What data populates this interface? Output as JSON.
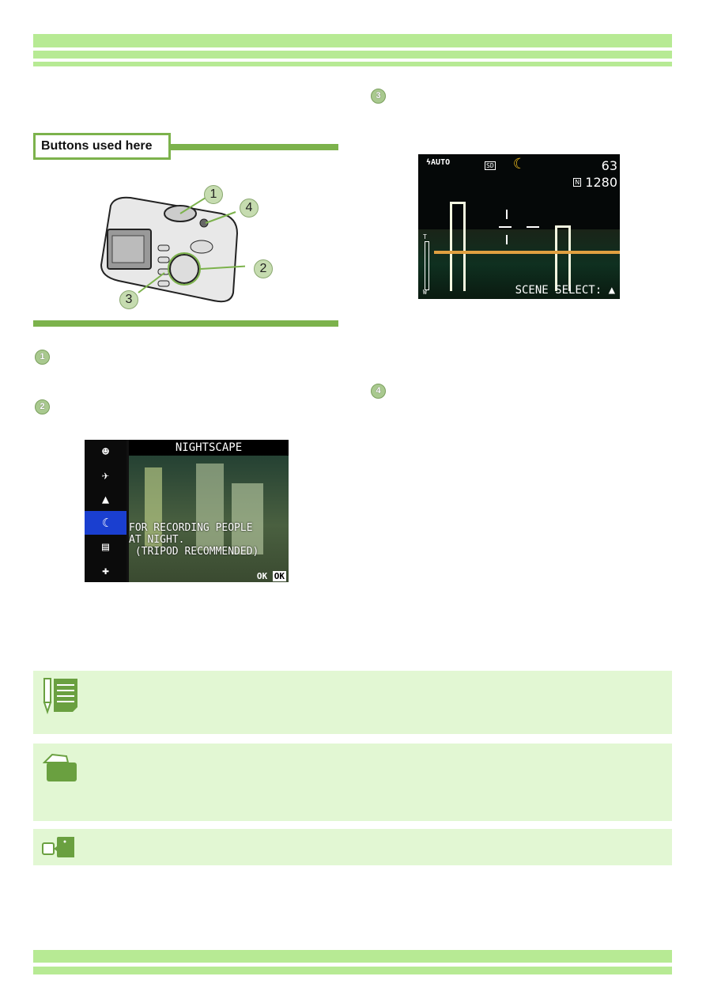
{
  "section": {
    "buttons_heading": "Buttons used here"
  },
  "camera_callouts": [
    "1",
    "2",
    "3",
    "4"
  ],
  "steps": [
    "1",
    "2",
    "3",
    "4"
  ],
  "scene_menu": {
    "title": "NIGHTSCAPE",
    "description_lines": [
      "FOR RECORDING PEOPLE",
      "AT NIGHT.",
      " (TRIPOD RECOMMENDED)"
    ],
    "ok_label": "OK",
    "ok_key": "OK",
    "icons": [
      "portrait-icon",
      "sports-icon",
      "landscape-icon",
      "nightscape-icon",
      "text-icon",
      "high-sensitivity-icon"
    ],
    "selected_index": 3
  },
  "shooting_screen": {
    "flash": "AUTO",
    "card": "SD",
    "remaining": "63",
    "quality": "N",
    "size": "1280",
    "zoom_top": "T",
    "zoom_bottom": "W",
    "scene_select": "SCENE SELECT: ▲"
  },
  "notes": [
    "memo-icon",
    "reference-icon",
    "see-also-icon"
  ],
  "colors": {
    "band": "#b7ea94",
    "accent": "#7cb24c",
    "note_bg": "#e2f7d3",
    "menu_highlight": "#1a3fd0"
  }
}
